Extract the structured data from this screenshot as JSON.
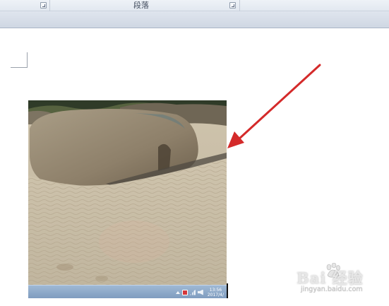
{
  "ribbon": {
    "group_label": "段落",
    "launcher_icon": "dialog-launcher-icon"
  },
  "document": {
    "image": {
      "subject": "sand-dune-and-rock-photo",
      "taskbar": {
        "clock_time": "13:56",
        "clock_date": "2017/4/"
      }
    },
    "annotation": {
      "arrow_color": "#d42a2a"
    }
  },
  "watermark": {
    "brand": "Bai 经验",
    "url": "jingyan.baidu.com"
  },
  "colors": {
    "ribbon_bg": "#e2e8f0",
    "taskbar": "#8aa6c8",
    "sand": "#cbbfa7"
  }
}
